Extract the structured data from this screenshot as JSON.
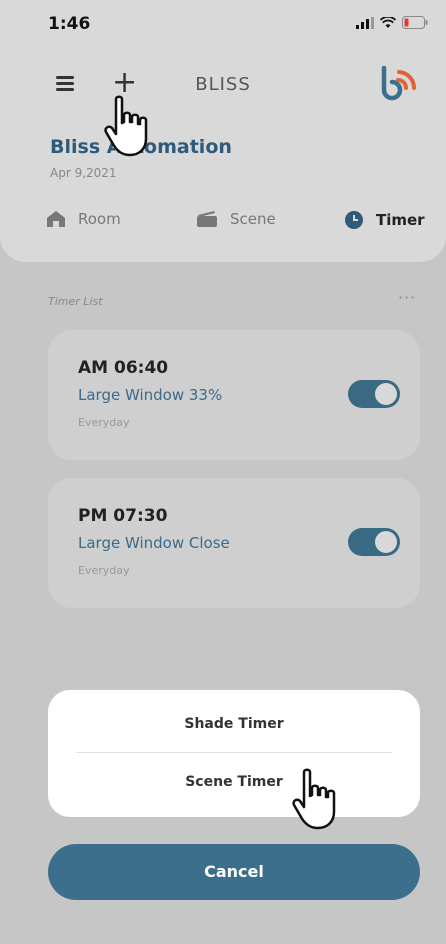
{
  "status_bar": {
    "time": "1:46",
    "icons": [
      "signal-icon",
      "wifi-icon",
      "battery-icon"
    ]
  },
  "header": {
    "app_title": "BLISS",
    "brand_name": "Bliss Automation",
    "date": "Apr 9,2021"
  },
  "nav": {
    "items": [
      {
        "label": "Room",
        "icon": "home-icon",
        "active": false
      },
      {
        "label": "Scene",
        "icon": "scene-icon",
        "active": false
      },
      {
        "label": "Timer",
        "icon": "clock-icon",
        "active": true
      }
    ]
  },
  "timer_list": {
    "label": "Timer List",
    "more": "···",
    "items": [
      {
        "time": "AM 06:40",
        "description": "Large Window 33%",
        "repeat": "Everyday",
        "enabled": true
      },
      {
        "time": "PM 07:30",
        "description": "Large Window Close",
        "repeat": "Everyday",
        "enabled": true
      }
    ]
  },
  "action_sheet": {
    "options": [
      "Shade Timer",
      "Scene Timer"
    ],
    "cancel_label": "Cancel"
  },
  "colors": {
    "accent": "#3b6f8b",
    "brand_text": "#2f5a79",
    "logo_orange": "#e0633a",
    "overlay": "#c6c6c6"
  }
}
